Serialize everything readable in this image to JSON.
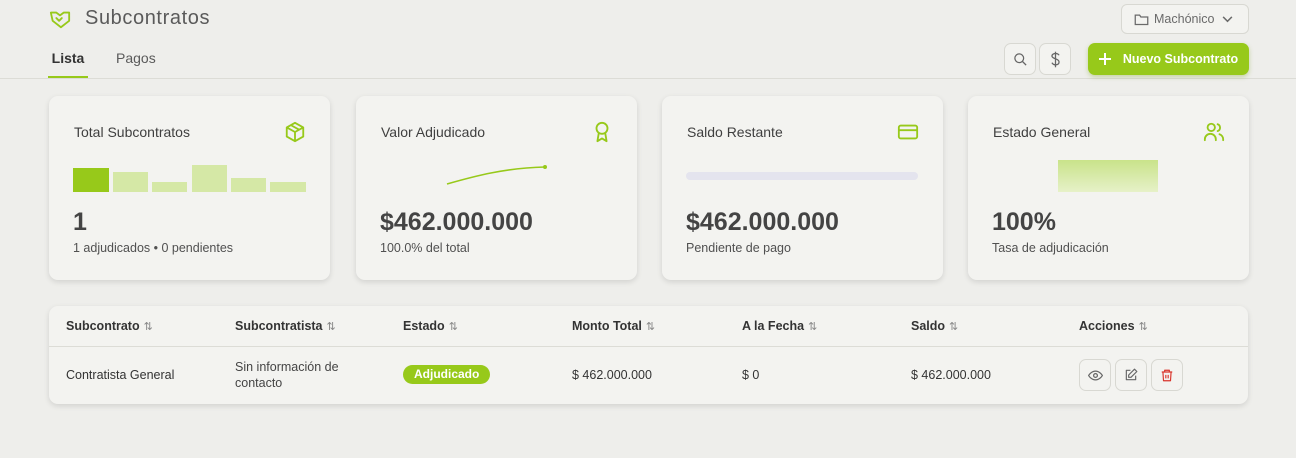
{
  "header": {
    "title": "Subcontratos",
    "project": "Machónico",
    "new_button": "Nuevo Subcontrato"
  },
  "tabs": [
    {
      "label": "Lista",
      "active": true
    },
    {
      "label": "Pagos",
      "active": false
    }
  ],
  "cards": [
    {
      "label": "Total Subcontratos",
      "value": "1",
      "sub": "1 adjudicados • 0 pendientes",
      "icon": "box-icon"
    },
    {
      "label": "Valor Adjudicado",
      "value": "$462.000.000",
      "sub": "100.0% del total",
      "icon": "award-icon"
    },
    {
      "label": "Saldo Restante",
      "value": "$462.000.000",
      "sub": "Pendiente de pago",
      "icon": "credit-card-icon"
    },
    {
      "label": "Estado General",
      "value": "100%",
      "sub": "Tasa de adjudicación",
      "icon": "users-icon"
    }
  ],
  "table": {
    "columns": [
      "Subcontrato",
      "Subcontratista",
      "Estado",
      "Monto Total",
      "A la Fecha",
      "Saldo",
      "Acciones"
    ],
    "rows": [
      {
        "subcontrato": "Contratista General",
        "subcontratista_line1": "Sin información de",
        "subcontratista_line2": "contacto",
        "estado": "Adjudicado",
        "monto_total": "$ 462.000.000",
        "a_la_fecha": "$ 0",
        "saldo": "$ 462.000.000"
      }
    ]
  },
  "colors": {
    "accent": "#97c91a",
    "accent_light": "#d5e8a6",
    "danger": "#d9342b",
    "background": "#eeeeeb"
  }
}
